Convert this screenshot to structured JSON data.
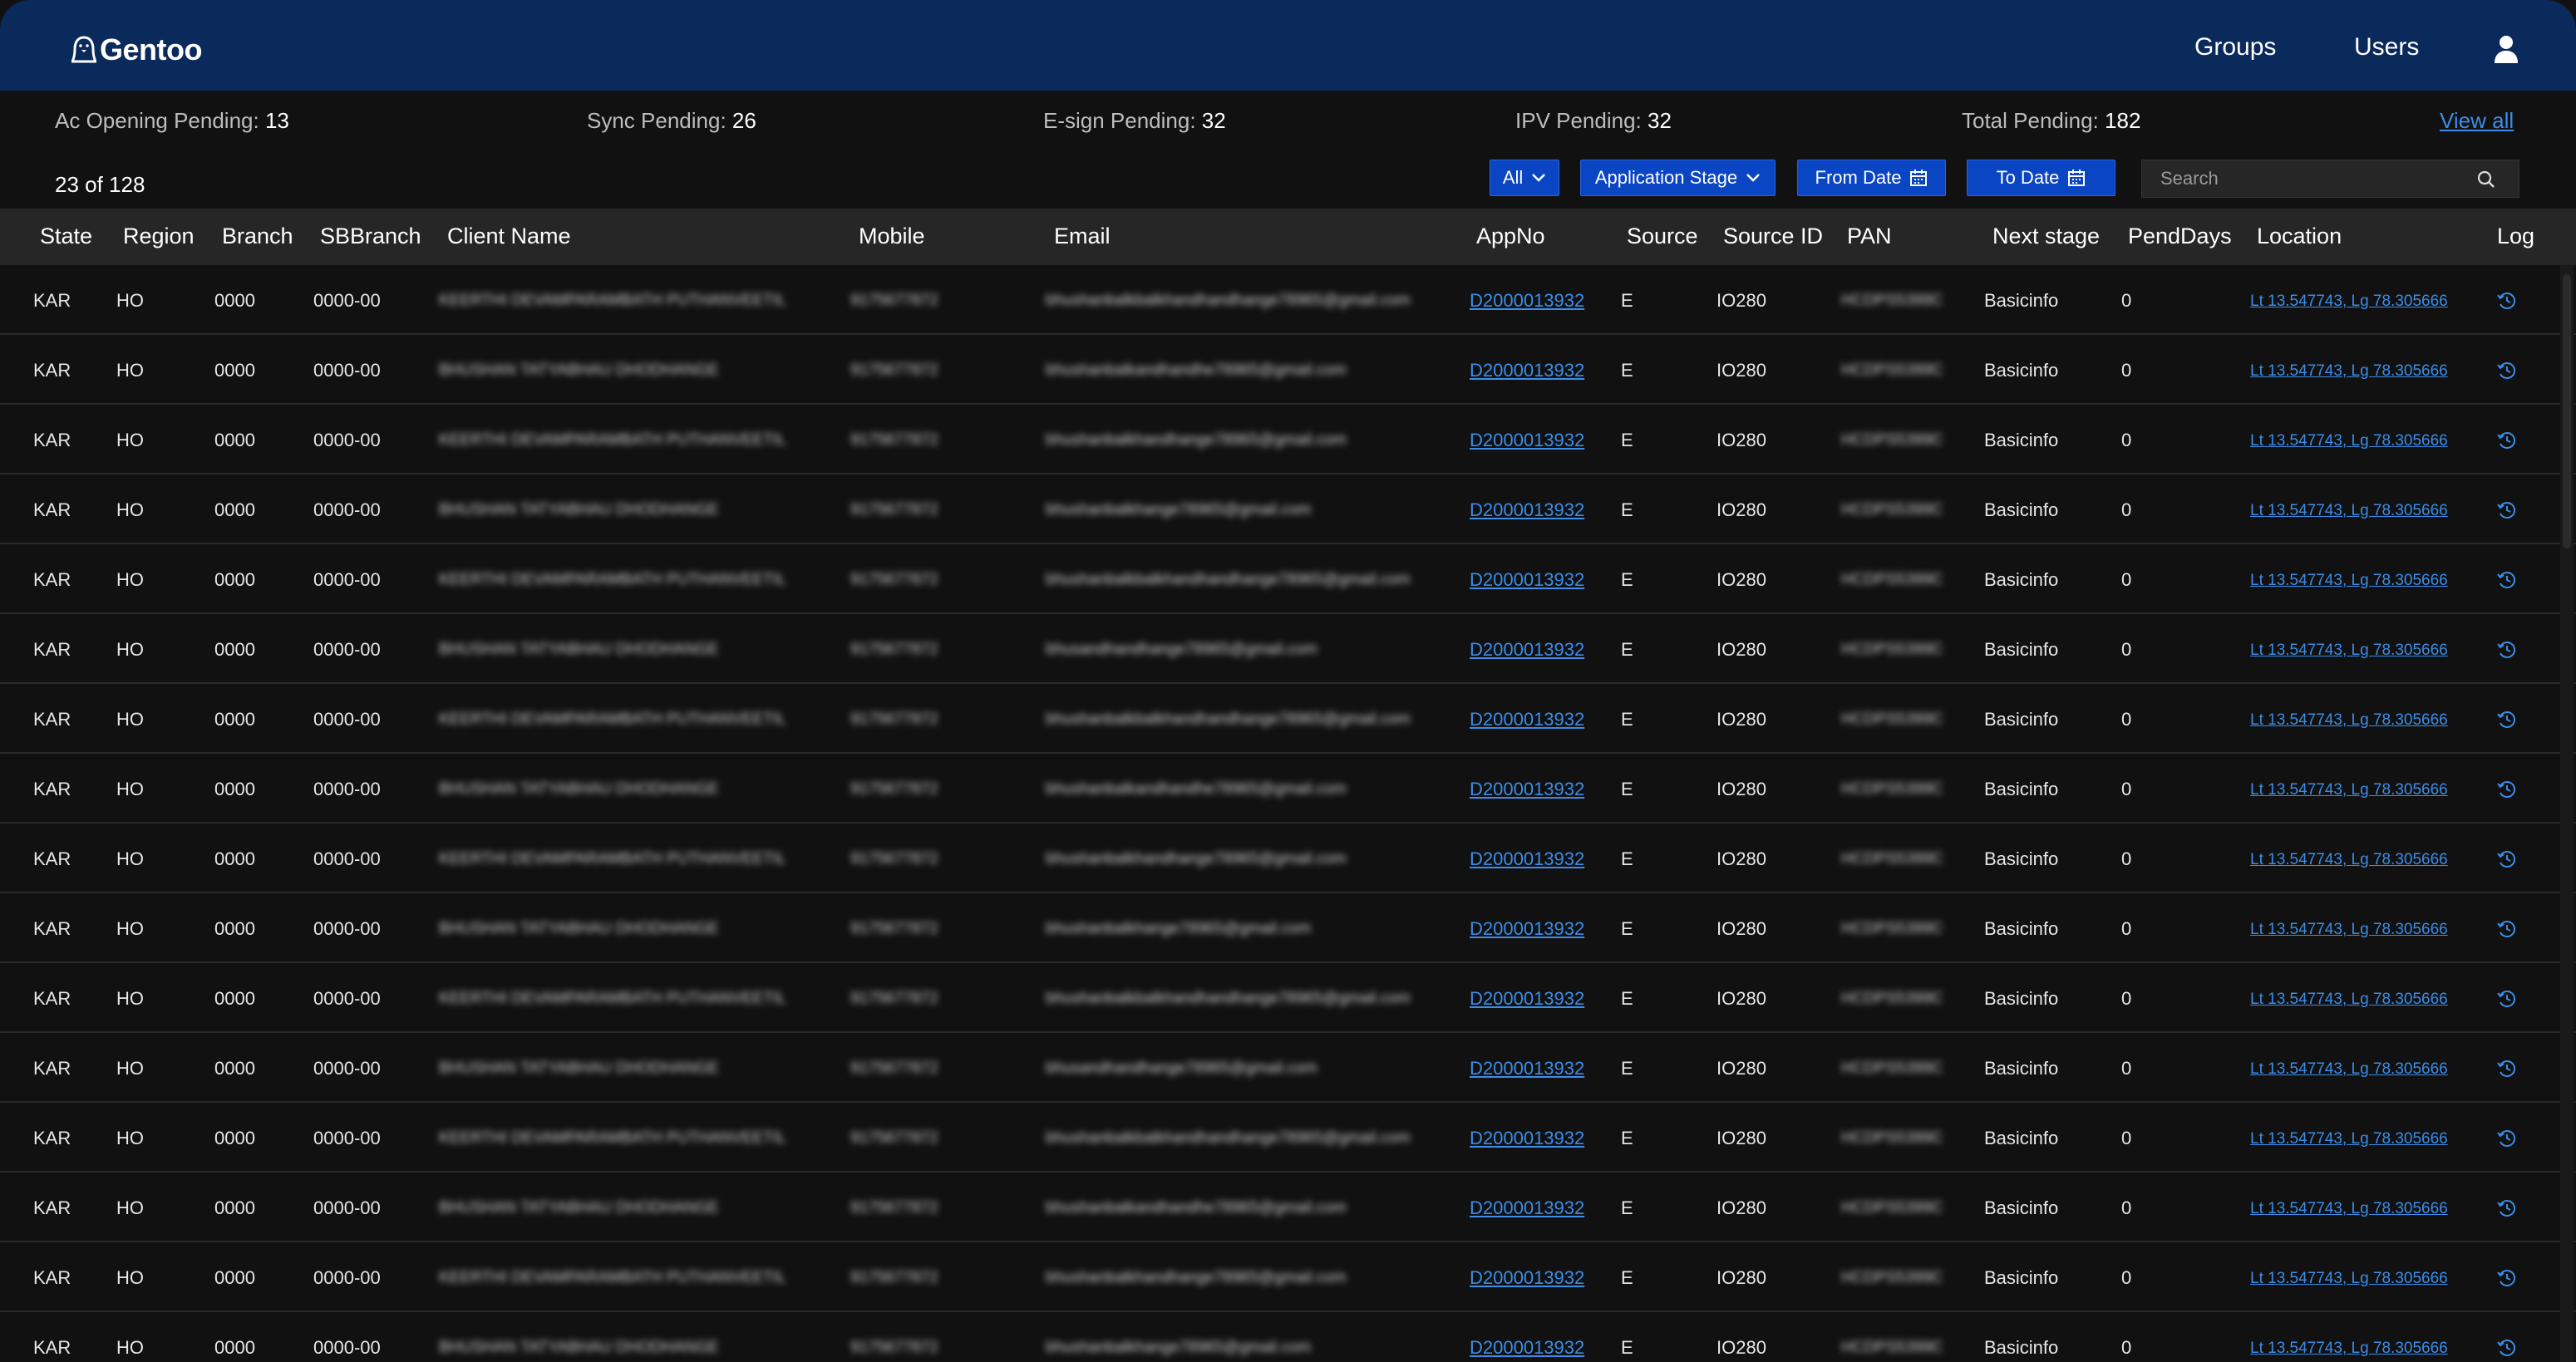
{
  "brand": {
    "name": "Gentoo"
  },
  "nav": {
    "groups": "Groups",
    "users": "Users"
  },
  "stats": [
    {
      "label": "Ac Opening Pending:",
      "value": "13"
    },
    {
      "label": "Sync Pending:",
      "value": "26"
    },
    {
      "label": "E-sign Pending:",
      "value": "32"
    },
    {
      "label": "IPV Pending:",
      "value": "32"
    },
    {
      "label": "Total Pending:",
      "value": "182"
    }
  ],
  "view_all": "View all",
  "record_count": "23 of 128",
  "filters": {
    "all": "All",
    "stage": "Application Stage",
    "from_date": "From Date",
    "to_date": "To Date",
    "search_placeholder": "Search"
  },
  "columns": [
    "State",
    "Region",
    "Branch",
    "SBBranch",
    "Client Name",
    "Mobile",
    "Email",
    "AppNo",
    "Source",
    "Source ID",
    "PAN",
    "Next stage",
    "PendDays",
    "Location",
    "Log"
  ],
  "rows": [
    {
      "state": "KAR",
      "region": "HO",
      "branch": "0000",
      "sbbranch": "0000-00",
      "client": "KEERTHI DEVAMPARAMBATH PUTHANVEETIL",
      "mobile": "9175677872",
      "email": "bhushanbalkbalkhandhandhange78965@gmail.com",
      "appno": "D2000013932",
      "source": "E",
      "source_id": "IO280",
      "pan": "HCDPS5399C",
      "next_stage": "Basicinfo",
      "pend_days": "0",
      "location": "Lt 13.547743, Lg 78.305666"
    },
    {
      "state": "KAR",
      "region": "HO",
      "branch": "0000",
      "sbbranch": "0000-00",
      "client": "BHUSHAN TATYABHAU DHODHANGE",
      "mobile": "9175677872",
      "email": "bhushanbalkandhandhe78965@gmail.com",
      "appno": "D2000013932",
      "source": "E",
      "source_id": "IO280",
      "pan": "HCDPS5399C",
      "next_stage": "Basicinfo",
      "pend_days": "0",
      "location": "Lt 13.547743, Lg 78.305666"
    },
    {
      "state": "KAR",
      "region": "HO",
      "branch": "0000",
      "sbbranch": "0000-00",
      "client": "KEERTHI DEVAMPARAMBATH PUTHANVEETIL",
      "mobile": "9175677872",
      "email": "bhushanbalkhandhange78965@gmail.com",
      "appno": "D2000013932",
      "source": "E",
      "source_id": "IO280",
      "pan": "HCDPS5399C",
      "next_stage": "Basicinfo",
      "pend_days": "0",
      "location": "Lt 13.547743, Lg 78.305666"
    },
    {
      "state": "KAR",
      "region": "HO",
      "branch": "0000",
      "sbbranch": "0000-00",
      "client": "BHUSHAN TATYABHAU DHODHANGE",
      "mobile": "9175677872",
      "email": "bhushanbalkhange78965@gmail.com",
      "appno": "D2000013932",
      "source": "E",
      "source_id": "IO280",
      "pan": "HCDPS5399C",
      "next_stage": "Basicinfo",
      "pend_days": "0",
      "location": "Lt 13.547743, Lg 78.305666"
    },
    {
      "state": "KAR",
      "region": "HO",
      "branch": "0000",
      "sbbranch": "0000-00",
      "client": "KEERTHI DEVAMPARAMBATH PUTHANVEETIL",
      "mobile": "9175677872",
      "email": "bhushanbalkbalkhandhandhange78965@gmail.com",
      "appno": "D2000013932",
      "source": "E",
      "source_id": "IO280",
      "pan": "HCDPS5399C",
      "next_stage": "Basicinfo",
      "pend_days": "0",
      "location": "Lt 13.547743, Lg 78.305666"
    },
    {
      "state": "KAR",
      "region": "HO",
      "branch": "0000",
      "sbbranch": "0000-00",
      "client": "BHUSHAN TATYABHAU DHODHANGE",
      "mobile": "9175677872",
      "email": "bhusandhandhange78965@gmail.com",
      "appno": "D2000013932",
      "source": "E",
      "source_id": "IO280",
      "pan": "HCDPS5399C",
      "next_stage": "Basicinfo",
      "pend_days": "0",
      "location": "Lt 13.547743, Lg 78.305666"
    },
    {
      "state": "KAR",
      "region": "HO",
      "branch": "0000",
      "sbbranch": "0000-00",
      "client": "KEERTHI DEVAMPARAMBATH PUTHANVEETIL",
      "mobile": "9175677872",
      "email": "bhushanbalkbalkhandhandhange78965@gmail.com",
      "appno": "D2000013932",
      "source": "E",
      "source_id": "IO280",
      "pan": "HCDPS5399C",
      "next_stage": "Basicinfo",
      "pend_days": "0",
      "location": "Lt 13.547743, Lg 78.305666"
    },
    {
      "state": "KAR",
      "region": "HO",
      "branch": "0000",
      "sbbranch": "0000-00",
      "client": "BHUSHAN TATYABHAU DHODHANGE",
      "mobile": "9175677872",
      "email": "bhushanbalkandhandhe78965@gmail.com",
      "appno": "D2000013932",
      "source": "E",
      "source_id": "IO280",
      "pan": "HCDPS5399C",
      "next_stage": "Basicinfo",
      "pend_days": "0",
      "location": "Lt 13.547743, Lg 78.305666"
    },
    {
      "state": "KAR",
      "region": "HO",
      "branch": "0000",
      "sbbranch": "0000-00",
      "client": "KEERTHI DEVAMPARAMBATH PUTHANVEETIL",
      "mobile": "9175677872",
      "email": "bhushanbalkhandhange78965@gmail.com",
      "appno": "D2000013932",
      "source": "E",
      "source_id": "IO280",
      "pan": "HCDPS5399C",
      "next_stage": "Basicinfo",
      "pend_days": "0",
      "location": "Lt 13.547743, Lg 78.305666"
    },
    {
      "state": "KAR",
      "region": "HO",
      "branch": "0000",
      "sbbranch": "0000-00",
      "client": "BHUSHAN TATYABHAU DHODHANGE",
      "mobile": "9175677872",
      "email": "bhushanbalkhange78965@gmail.com",
      "appno": "D2000013932",
      "source": "E",
      "source_id": "IO280",
      "pan": "HCDPS5399C",
      "next_stage": "Basicinfo",
      "pend_days": "0",
      "location": "Lt 13.547743, Lg 78.305666"
    },
    {
      "state": "KAR",
      "region": "HO",
      "branch": "0000",
      "sbbranch": "0000-00",
      "client": "KEERTHI DEVAMPARAMBATH PUTHANVEETIL",
      "mobile": "9175677872",
      "email": "bhushanbalkbalkhandhandhange78965@gmail.com",
      "appno": "D2000013932",
      "source": "E",
      "source_id": "IO280",
      "pan": "HCDPS5399C",
      "next_stage": "Basicinfo",
      "pend_days": "0",
      "location": "Lt 13.547743, Lg 78.305666"
    },
    {
      "state": "KAR",
      "region": "HO",
      "branch": "0000",
      "sbbranch": "0000-00",
      "client": "BHUSHAN TATYABHAU DHODHANGE",
      "mobile": "9175677872",
      "email": "bhusandhandhange78965@gmail.com",
      "appno": "D2000013932",
      "source": "E",
      "source_id": "IO280",
      "pan": "HCDPS5399C",
      "next_stage": "Basicinfo",
      "pend_days": "0",
      "location": "Lt 13.547743, Lg 78.305666"
    },
    {
      "state": "KAR",
      "region": "HO",
      "branch": "0000",
      "sbbranch": "0000-00",
      "client": "KEERTHI DEVAMPARAMBATH PUTHANVEETIL",
      "mobile": "9175677872",
      "email": "bhushanbalkbalkhandhandhange78965@gmail.com",
      "appno": "D2000013932",
      "source": "E",
      "source_id": "IO280",
      "pan": "HCDPS5399C",
      "next_stage": "Basicinfo",
      "pend_days": "0",
      "location": "Lt 13.547743, Lg 78.305666"
    },
    {
      "state": "KAR",
      "region": "HO",
      "branch": "0000",
      "sbbranch": "0000-00",
      "client": "BHUSHAN TATYABHAU DHODHANGE",
      "mobile": "9175677872",
      "email": "bhushanbalkandhandhe78965@gmail.com",
      "appno": "D2000013932",
      "source": "E",
      "source_id": "IO280",
      "pan": "HCDPS5399C",
      "next_stage": "Basicinfo",
      "pend_days": "0",
      "location": "Lt 13.547743, Lg 78.305666"
    },
    {
      "state": "KAR",
      "region": "HO",
      "branch": "0000",
      "sbbranch": "0000-00",
      "client": "KEERTHI DEVAMPARAMBATH PUTHANVEETIL",
      "mobile": "9175677872",
      "email": "bhushanbalkhandhange78965@gmail.com",
      "appno": "D2000013932",
      "source": "E",
      "source_id": "IO280",
      "pan": "HCDPS5399C",
      "next_stage": "Basicinfo",
      "pend_days": "0",
      "location": "Lt 13.547743, Lg 78.305666"
    },
    {
      "state": "KAR",
      "region": "HO",
      "branch": "0000",
      "sbbranch": "0000-00",
      "client": "BHUSHAN TATYABHAU DHODHANGE",
      "mobile": "9175677872",
      "email": "bhushanbalkhange78965@gmail.com",
      "appno": "D2000013932",
      "source": "E",
      "source_id": "IO280",
      "pan": "HCDPS5399C",
      "next_stage": "Basicinfo",
      "pend_days": "0",
      "location": "Lt 13.547743, Lg 78.305666"
    }
  ],
  "colors": {
    "header_bg": "#0b2a5c",
    "page_bg": "#111111",
    "button_bg": "#0a45c4",
    "link": "#3b8de8"
  },
  "icons": {
    "logo": "penguin-icon",
    "user": "user-icon",
    "date": "calendar-icon",
    "dropdown": "chevron-down-icon",
    "search": "search-icon",
    "log": "refresh-clock-icon"
  }
}
